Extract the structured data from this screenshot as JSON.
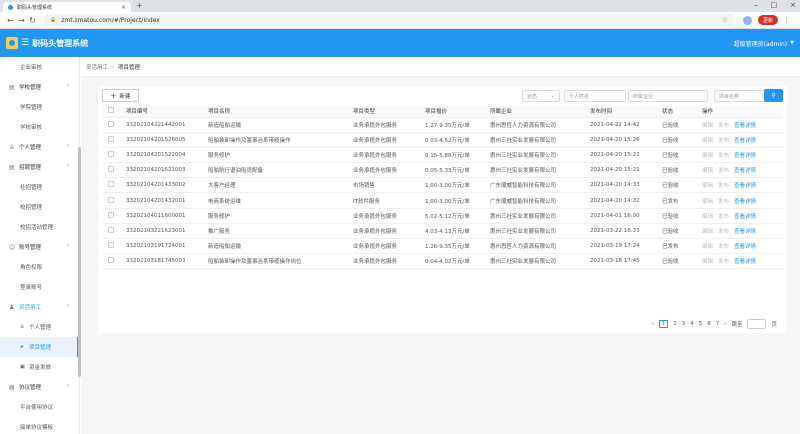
{
  "browser": {
    "tab_title": "职码头管理系统",
    "url": "zmt.zmatou.com/#/Project/Index",
    "update_label": "更新"
  },
  "app": {
    "title": "职码头管理系统",
    "user": "超级管理员(admin)"
  },
  "sidebar": {
    "items": [
      {
        "label": "企业审核",
        "kind": "sub"
      },
      {
        "label": "学校管理",
        "kind": "group",
        "icon": "document-icon"
      },
      {
        "label": "学院管理",
        "kind": "sub"
      },
      {
        "label": "学校审核",
        "kind": "sub"
      },
      {
        "label": "个人管理",
        "kind": "group",
        "icon": "person-icon"
      },
      {
        "label": "招聘管理",
        "kind": "group",
        "icon": "document-icon"
      },
      {
        "label": "社招管理",
        "kind": "sub"
      },
      {
        "label": "校招管理",
        "kind": "sub"
      },
      {
        "label": "校招活动管理",
        "kind": "sub"
      },
      {
        "label": "账号管理",
        "kind": "group",
        "icon": "user-icon"
      },
      {
        "label": "角色权限",
        "kind": "sub"
      },
      {
        "label": "登录账号",
        "kind": "sub"
      },
      {
        "label": "灵活用工",
        "kind": "group-open",
        "icon": "people-icon"
      },
      {
        "label": "个人管理",
        "kind": "sub-icon",
        "icon": "person-icon"
      },
      {
        "label": "项目管理",
        "kind": "active",
        "icon": "folder-icon"
      },
      {
        "label": "资金发放",
        "kind": "sub-icon",
        "icon": "wallet-icon"
      },
      {
        "label": "协议管理",
        "kind": "group",
        "icon": "document-icon"
      },
      {
        "label": "平台使用协议",
        "kind": "sub"
      },
      {
        "label": "接单协议模板",
        "kind": "sub"
      }
    ]
  },
  "breadcrumb": {
    "parent": "灵活用工",
    "current": "项目管理"
  },
  "toolbar": {
    "new_label": "新建",
    "status_placeholder": "状态",
    "person_placeholder": "个人姓名",
    "company_placeholder": "所属企业",
    "project_placeholder": "项目名称"
  },
  "table": {
    "headers": [
      "项目编号",
      "项目名称",
      "项目类型",
      "项目报价",
      "所属企业",
      "发布时间",
      "状态",
      "操作"
    ],
    "rows": [
      [
        "33202104221442001",
        "新造船舶运输",
        "业务承揽外包服务",
        "1.27-9.35万元/单",
        "惠州思哲人力资源有限公司",
        "2021-04-22 14:42",
        "已验收"
      ],
      [
        "33202104201526005",
        "船舶装卸操作及塞事治系带缆操作",
        "业务承揽外包服务",
        "0.03-4.52万元/单",
        "惠州三社实业发展有限公司",
        "2021-04-20 15:26",
        "已验收"
      ],
      [
        "33202104201522004",
        "服务修护",
        "业务承揽外包服务",
        "0.15-5.86万元/单",
        "惠州三社实业发展有限公司",
        "2021-04-20 15:22",
        "已验收"
      ],
      [
        "33202104201521003",
        "船舶航行退泊船员配备",
        "业务承揽外包服务",
        "0.05-5.33万元/单",
        "惠州三社实业发展有限公司",
        "2021-04-20 15:21",
        "已验收"
      ],
      [
        "33202104201433002",
        "大客户经理",
        "市场销售",
        "1.00-3.00万元/单",
        "广东顺威智能科技有限公司",
        "2021-04-20 14:33",
        "已验收"
      ],
      [
        "33202104201432001",
        "电商系统运维",
        "IT软件服务",
        "1.00-3.00万元/单",
        "广东顺威智能科技有限公司",
        "2021-04-20 14:32",
        "已发布"
      ],
      [
        "33202104011600001",
        "服务修护",
        "业务承揽外包服务",
        "5.02-5.12万元/单",
        "惠州三社实业发展有限公司",
        "2021-04-01 16:00",
        "已验收"
      ],
      [
        "33202103221623001",
        "推广服务",
        "业务承揽外包服务",
        "4.03-4.13万元/单",
        "惠州三社实业发展有限公司",
        "2021-03-22 16:23",
        "已验收"
      ],
      [
        "33202103191724001",
        "新造船舶运输",
        "业务承揽外包服务",
        "1.26-9.35万元/单",
        "惠州思哲人力资源有限公司",
        "2021-03-19 17:24",
        "已发布"
      ],
      [
        "33202103181745003",
        "船舶装卸操作及塞事治系带缆操作岗位",
        "业务承揽外包服务",
        "0.04-4.02万元/单",
        "惠州三社实业发展有限公司",
        "2021-03-18 17:45",
        "已验收"
      ]
    ],
    "ops": {
      "edit": "编辑",
      "publish": "发布",
      "view": "查看详情"
    }
  },
  "pager": {
    "pages": [
      "1",
      "2",
      "3",
      "4",
      "5",
      "6",
      "7"
    ],
    "current": "1",
    "jump_label": "跳至",
    "page_suffix": "页"
  }
}
